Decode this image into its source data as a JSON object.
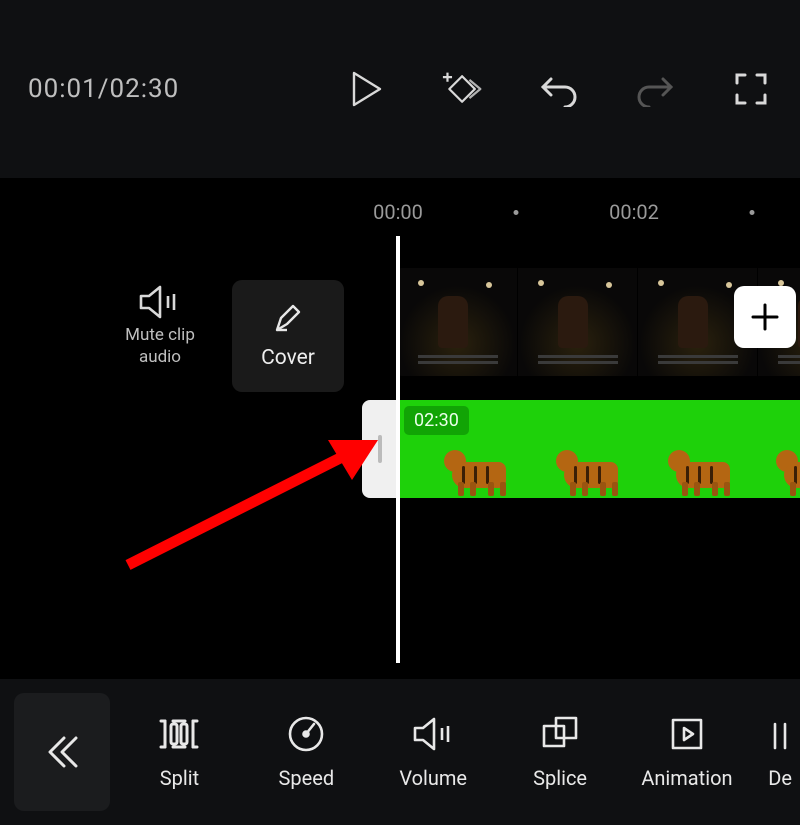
{
  "topbar": {
    "current_time": "00:01",
    "total_time": "02:30",
    "separator": "/"
  },
  "ruler": {
    "ticks": [
      "00:00",
      "00:02"
    ]
  },
  "leftbox": {
    "mute_label_line1": "Mute clip",
    "mute_label_line2": "audio",
    "cover_label": "Cover"
  },
  "overlay_clip": {
    "duration_badge": "02:30"
  },
  "bottom": {
    "tools": {
      "split": "Split",
      "speed": "Speed",
      "volume": "Volume",
      "splice": "Splice",
      "animation": "Animation",
      "delete_partial": "De"
    }
  },
  "colors": {
    "greenscreen": "#1ed10a",
    "badge": "#11a405",
    "arrow": "#ff0000"
  }
}
